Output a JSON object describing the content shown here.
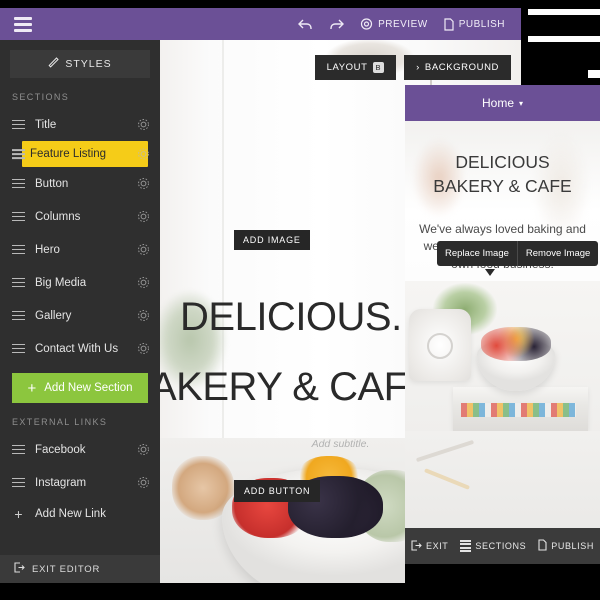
{
  "topbar": {
    "menu_icon": "hamburger-icon",
    "undo_icon": "undo-arrow-icon",
    "redo_icon": "redo-arrow-icon",
    "preview_label": "PREVIEW",
    "preview_icon": "eye-icon",
    "publish_label": "PUBLISH",
    "publish_icon": "document-icon",
    "accent_color": "#6b5096"
  },
  "sidebar": {
    "styles_label": "STYLES",
    "styles_icon": "brush-icon",
    "sections_heading": "SECTIONS",
    "sections": [
      {
        "label": "Title",
        "active": false
      },
      {
        "label": "Feature Listing",
        "active": true
      },
      {
        "label": "Button",
        "active": false
      },
      {
        "label": "Columns",
        "active": false
      },
      {
        "label": "Hero",
        "active": false
      },
      {
        "label": "Big Media",
        "active": false
      },
      {
        "label": "Gallery",
        "active": false
      },
      {
        "label": "Contact With Us",
        "active": false
      }
    ],
    "add_section_label": "Add New Section",
    "external_links_heading": "EXTERNAL LINKS",
    "links": [
      {
        "label": "Facebook"
      },
      {
        "label": "Instagram"
      }
    ],
    "add_link_label": "Add New Link",
    "exit_editor_label": "EXIT EDITOR",
    "exit_icon": "exit-door-icon",
    "active_color": "#f5cc18",
    "add_button_color": "#8cc63e"
  },
  "canvas": {
    "layout_label": "LAYOUT",
    "layout_badge": "B",
    "background_label": "BACKGROUND",
    "background_caret": "›",
    "add_image_label": "ADD IMAGE",
    "headline_line1": "DELICIOUS.",
    "headline_line2": "AKERY & CAFE",
    "subtitle_placeholder": "Add subtitle.",
    "add_button_label": "ADD BUTTON"
  },
  "mobile": {
    "page_label": "Home",
    "page_caret": "▾",
    "headline_line1": "DELICIOUS",
    "headline_line2": "BAKERY & CAFE",
    "body_text": "We've always loved baking and we've dreamed of starting our own food business!",
    "tooltip": {
      "replace_label": "Replace Image",
      "remove_label": "Remove Image"
    },
    "bottom_bar": [
      {
        "label": "EXIT",
        "icon": "exit-door-icon"
      },
      {
        "label": "SECTIONS",
        "icon": "sections-icon"
      },
      {
        "label": "PUBLISH",
        "icon": "document-icon"
      }
    ]
  }
}
